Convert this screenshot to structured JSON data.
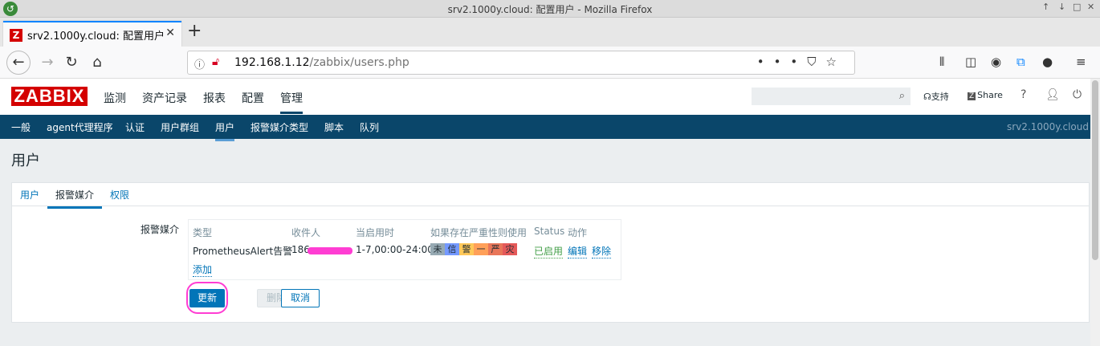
{
  "window": {
    "title": "srv2.1000y.cloud: 配置用户 - Mozilla Firefox",
    "controls": [
      "↑",
      "↓",
      "□",
      "✕"
    ]
  },
  "browser": {
    "tab_title": "srv2.1000y.cloud: 配置用户",
    "tab_favicon": "Z",
    "tab_close": "✕",
    "new_tab": "+",
    "url_host": "192.168.1.12",
    "url_path": "/zabbix/users.php"
  },
  "zabbix": {
    "logo": "ZABBIX",
    "menu": [
      "监测",
      "资产记录",
      "报表",
      "配置",
      "管理"
    ],
    "search_placeholder": "",
    "support": "支持",
    "share": "Share",
    "help": "?",
    "submenu": [
      "一般",
      "agent代理程序",
      "认证",
      "用户群组",
      "用户",
      "报警媒介类型",
      "脚本",
      "队列"
    ],
    "server_name": "srv2.1000y.cloud"
  },
  "page": {
    "title": "用户",
    "tabs": [
      "用户",
      "报警媒介",
      "权限"
    ],
    "form_label": "报警媒介",
    "media_table": {
      "headers": [
        "类型",
        "收件人",
        "当启用时",
        "如果存在严重性则使用",
        "Status",
        "动作"
      ],
      "row": {
        "type": "PrometheusAlert告警",
        "sendto": "186",
        "when_active": "1-7,00:00-24:00",
        "severities": [
          "未",
          "信",
          "警",
          "一",
          "严",
          "灾"
        ],
        "severity_colors": [
          "#97aab3",
          "#7499ff",
          "#ffc859",
          "#ffa059",
          "#e97659",
          "#e45959"
        ],
        "status": "已启用",
        "action_edit": "编辑",
        "action_remove": "移除"
      },
      "add": "添加"
    },
    "buttons": {
      "update": "更新",
      "delete": "删除",
      "cancel": "取消"
    }
  }
}
